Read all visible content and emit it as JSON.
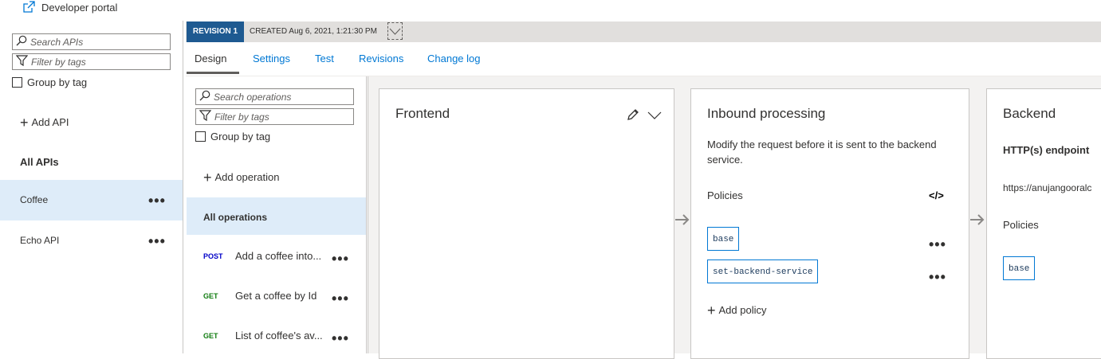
{
  "topbar": {
    "developer_portal": "Developer portal"
  },
  "left": {
    "search_placeholder": "Search APIs",
    "filter_placeholder": "Filter by tags",
    "group_by_tag": "Group by tag",
    "add_api": "Add API",
    "all_apis": "All APIs",
    "apis": [
      {
        "name": "Coffee",
        "selected": true
      },
      {
        "name": "Echo API",
        "selected": false
      }
    ]
  },
  "revision": {
    "badge": "REVISION 1",
    "created": "CREATED Aug 6, 2021, 1:21:30 PM"
  },
  "tabs": [
    "Design",
    "Settings",
    "Test",
    "Revisions",
    "Change log"
  ],
  "ops": {
    "search_placeholder": "Search operations",
    "filter_placeholder": "Filter by tags",
    "group_by_tag": "Group by tag",
    "add_operation": "Add operation",
    "all_operations": "All operations",
    "items": [
      {
        "verb": "POST",
        "name": "Add a coffee into..."
      },
      {
        "verb": "GET",
        "name": "Get a coffee by Id"
      },
      {
        "verb": "GET",
        "name": "List of coffee's av..."
      }
    ]
  },
  "frontend": {
    "title": "Frontend"
  },
  "inbound": {
    "title": "Inbound processing",
    "description": "Modify the request before it is sent to the backend service.",
    "policies_label": "Policies",
    "policies": [
      "base",
      "set-backend-service"
    ],
    "add_policy": "Add policy"
  },
  "backend": {
    "title": "Backend",
    "endpoint_label": "HTTP(s) endpoint",
    "endpoint_value": "https://anujangooralc",
    "policies_label": "Policies",
    "policies": [
      "base"
    ]
  },
  "colors": {
    "accent": "#0078d4",
    "selected_bg": "#deecf9",
    "revision_badge": "#1e5a91",
    "post": "#0000c8",
    "get": "#107c10"
  }
}
